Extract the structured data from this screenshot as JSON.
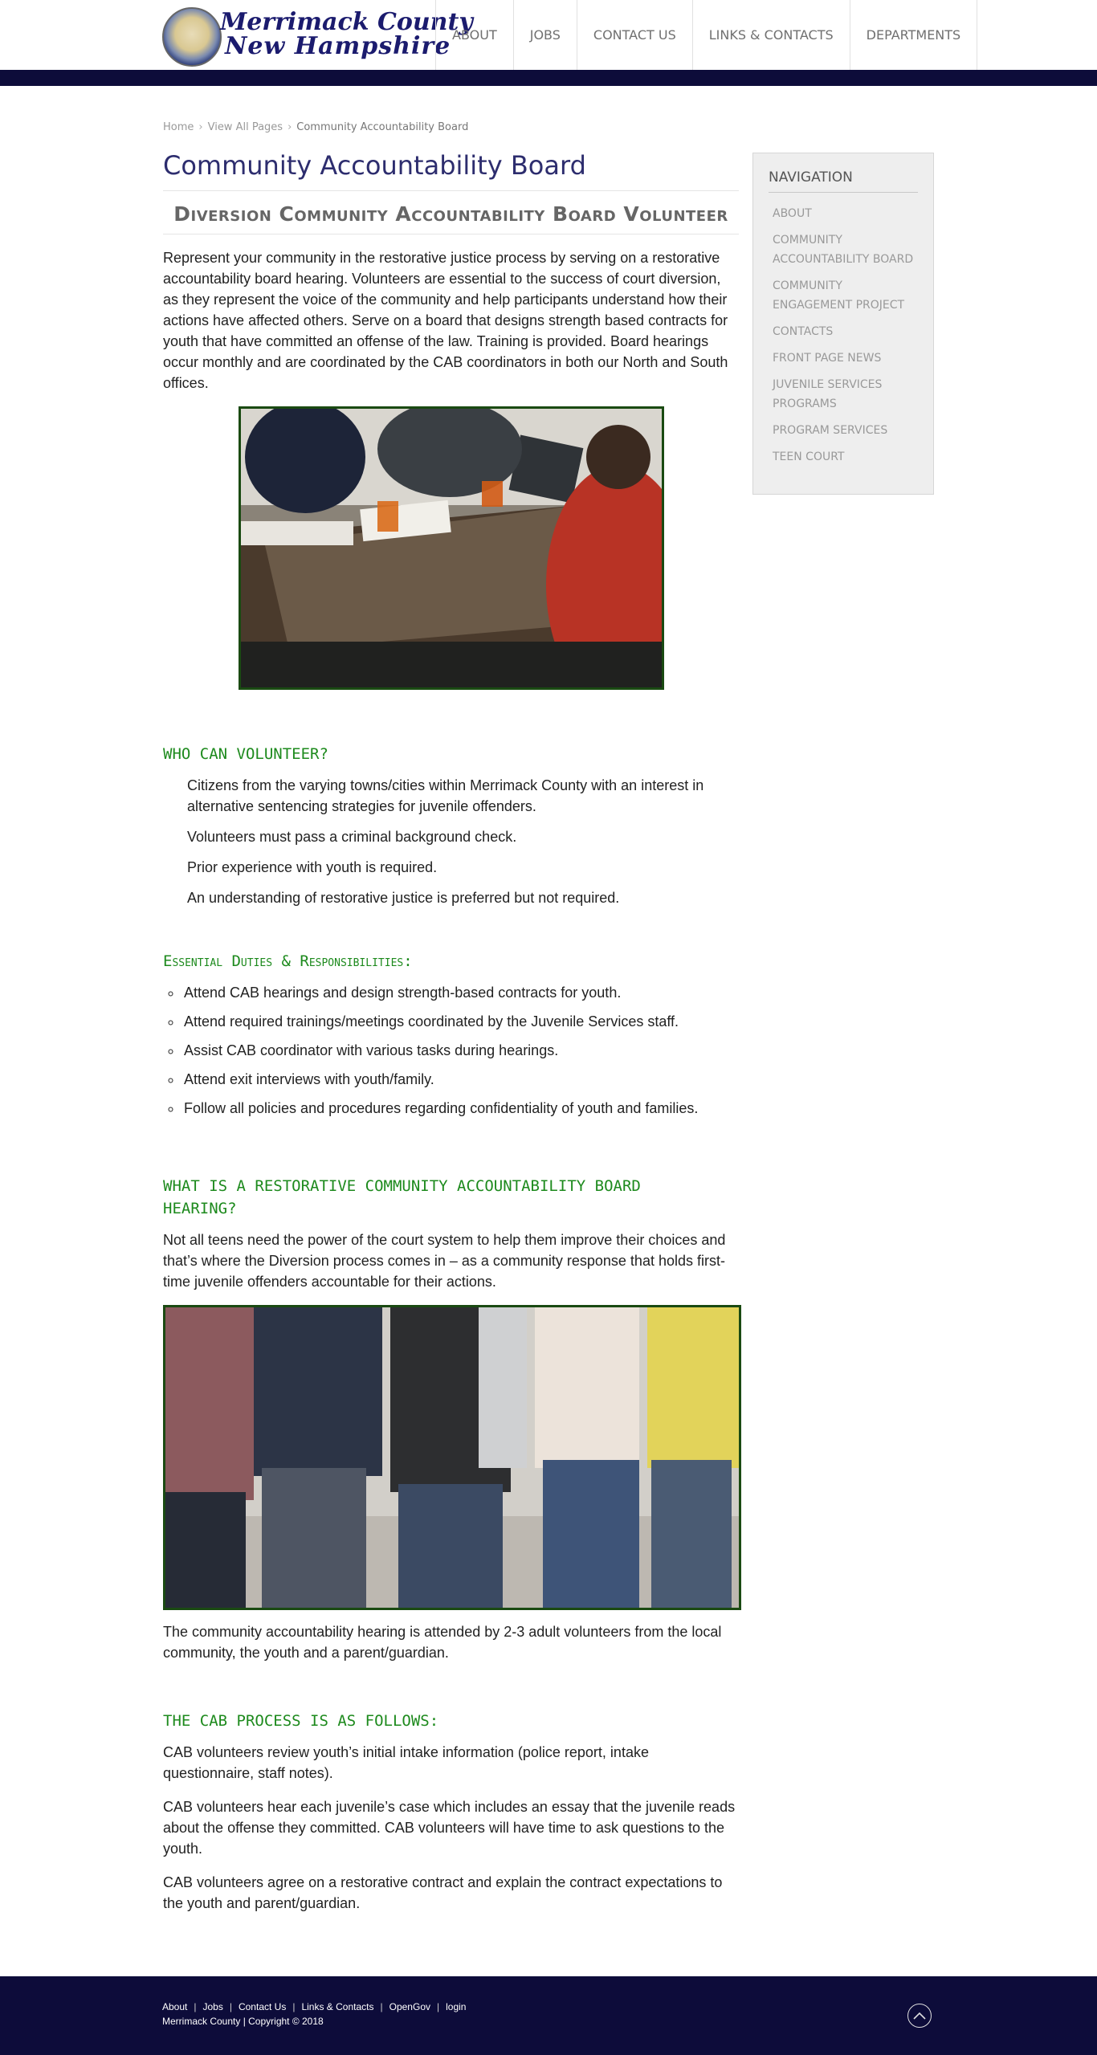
{
  "header": {
    "logo_line1": "Merrimack County",
    "logo_line2": "New Hampshire",
    "nav": [
      "ABOUT",
      "JOBS",
      "CONTACT US",
      "LINKS & CONTACTS",
      "DEPARTMENTS"
    ]
  },
  "breadcrumb": [
    "Home",
    "View All Pages",
    "Community Accountability Board"
  ],
  "main": {
    "title": "Community Accountability Board",
    "subtitle": "Diversion Community Accountability Board Volunteer",
    "intro": "Represent your community in the restorative justice process by serving on a restorative accountability board hearing. Volunteers are essential to the success of court diversion, as they represent the voice of the community and help participants understand how their actions have affected others. Serve on a board that designs strength based contracts for youth that have committed an offense of the law. Training is provided. Board hearings occur monthly and are coordinated by the CAB coordinators in both our North and South offices.",
    "who_heading": "WHO CAN VOLUNTEER?",
    "who_items": [
      "Citizens from the varying towns/cities within Merrimack County with an interest in alternative sentencing strategies for juvenile offenders.",
      "Volunteers must pass a criminal background check.",
      "Prior experience with youth is required.",
      "An understanding of restorative justice is preferred but not required."
    ],
    "duties_heading": "Essential Duties & Responsibilities:",
    "duties": [
      "Attend CAB hearings and design strength-based contracts for youth.",
      "Attend required trainings/meetings coordinated by the Juvenile Services staff.",
      "Assist CAB coordinator with various tasks during hearings.",
      "Attend exit interviews with youth/family.",
      "Follow all policies and procedures regarding confidentiality of youth and families."
    ],
    "what_heading": "WHAT IS A RESTORATIVE COMMUNITY ACCOUNTABILITY BOARD HEARING?",
    "what_text": "Not all teens need the power of the court system to help them improve their choices and that’s where the Diversion process comes in – as a community response that holds first-time juvenile offenders accountable for their actions.",
    "hearing_text": "The community accountability hearing is attended by 2-3 adult volunteers from the local community, the youth and a parent/guardian.",
    "process_heading": "THE CAB PROCESS IS AS FOLLOWS:",
    "process_items": [
      "CAB volunteers review youth’s initial intake information (police report, intake questionnaire, staff notes).",
      "CAB volunteers hear each juvenile’s case which includes an essay that the juvenile reads about the offense they committed. CAB volunteers will have time to ask questions to the youth.",
      "CAB volunteers agree on a restorative contract and explain the contract expectations to the youth and parent/guardian."
    ]
  },
  "sidebar": {
    "heading": "NAVIGATION",
    "items": [
      "ABOUT",
      "COMMUNITY ACCOUNTABILITY BOARD",
      "COMMUNITY ENGAGEMENT PROJECT",
      "CONTACTS",
      "FRONT PAGE NEWS",
      "JUVENILE SERVICES PROGRAMS",
      "PROGRAM SERVICES",
      "TEEN COURT"
    ]
  },
  "footer": {
    "links": [
      "About",
      "Jobs",
      "Contact Us",
      "Links & Contacts",
      "OpenGov",
      "login"
    ],
    "copyright": "Merrimack County | Copyright © 2018"
  },
  "colors": {
    "navy": "#0d0c3a",
    "heading_green": "#1d8a1d",
    "title_blue": "#2d2d6e"
  },
  "icons": [
    "county-seal-icon",
    "chevron-right-icon",
    "back-to-top-icon"
  ]
}
